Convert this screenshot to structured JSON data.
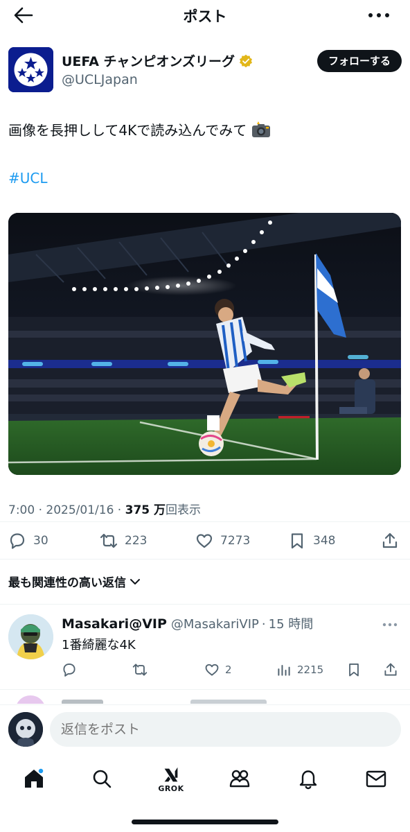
{
  "header": {
    "title": "ポスト",
    "back_icon": "arrow-left-icon",
    "more_icon": "more-horizontal-icon"
  },
  "author": {
    "name": "UEFA チャンピオンズリーグ",
    "handle": "@UCLJapan",
    "verified_color": "#e2b719",
    "follow_label": "フォローする"
  },
  "post": {
    "text": "画像を長押しして4Kで読み込んでみて",
    "emoji_icon": "camera-flash-icon",
    "hashtag": "#UCL",
    "time": "7:00",
    "date": "2025/01/16",
    "views": "375 万",
    "views_suffix": "回表示"
  },
  "stats": {
    "replies": "30",
    "reposts": "223",
    "likes": "7273",
    "bookmarks": "348"
  },
  "replies_section": {
    "sort_label": "最も関連性の高い返信"
  },
  "reply": {
    "name": "Masakari@VIP",
    "handle": "@MasakariVIP",
    "separator": "·",
    "time": "15 時間",
    "text": "1番綺麗な4K",
    "likes": "2",
    "views": "2215"
  },
  "composer": {
    "placeholder": "返信をポスト"
  },
  "tabbar": {
    "grok_label": "GROK",
    "notification_dot_color": "#1d9bf0"
  },
  "colors": {
    "accent": "#1d9bf0",
    "text": "#0f1419",
    "secondary": "#536471"
  }
}
